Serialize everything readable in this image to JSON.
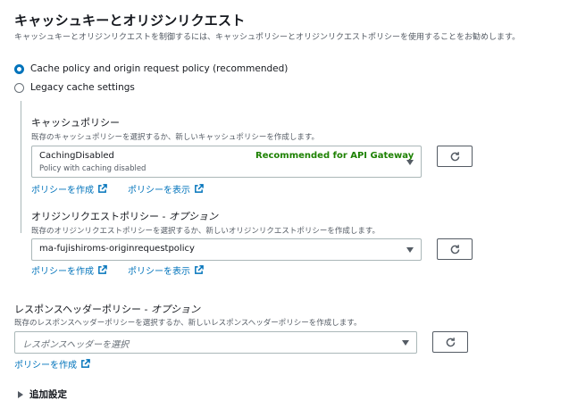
{
  "header": {
    "title": "キャッシュキーとオリジンリクエスト",
    "description": "キャッシュキーとオリジンリクエストを制御するには、キャッシュポリシーとオリジンリクエストポリシーを使用することをお勧めします。"
  },
  "options": [
    {
      "label": "Cache policy and origin request policy (recommended)",
      "selected": true
    },
    {
      "label": "Legacy cache settings",
      "selected": false
    }
  ],
  "cache_policy": {
    "label": "キャッシュポリシー",
    "description": "既存のキャッシュポリシーを選択するか、新しいキャッシュポリシーを作成します。",
    "selected": "CachingDisabled",
    "selected_desc": "Policy with caching disabled",
    "recommendation": "Recommended for API Gateway",
    "create_link": "ポリシーを作成",
    "view_link": "ポリシーを表示"
  },
  "origin_request_policy": {
    "label": "オリジンリクエストポリシー - ",
    "label_optional": "オプション",
    "description": "既存のオリジンリクエストポリシーを選択するか、新しいオリジンリクエストポリシーを作成します。",
    "selected": "ma-fujishiroms-originrequestpolicy",
    "create_link": "ポリシーを作成",
    "view_link": "ポリシーを表示"
  },
  "response_headers_policy": {
    "label": "レスポンスヘッダーポリシー - ",
    "label_optional": "オプション",
    "description": "既存のレスポンスヘッダーポリシーを選択するか、新しいレスポンスヘッダーポリシーを作成します。",
    "placeholder": "レスポンスヘッダーを選択",
    "create_link": "ポリシーを作成"
  },
  "additional": {
    "label": "追加設定"
  },
  "colors": {
    "accent": "#0073bb",
    "recommended": "#1d8102",
    "text": "#16191f",
    "muted": "#545b64"
  }
}
